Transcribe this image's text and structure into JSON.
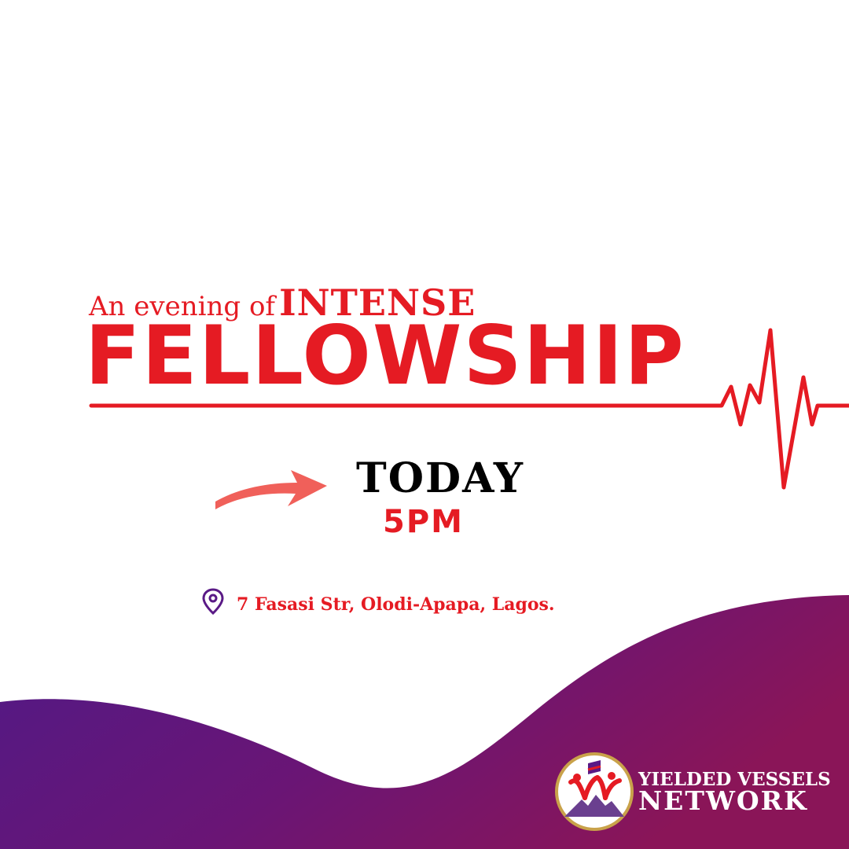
{
  "headline": {
    "pre_title": "An evening of",
    "pre_title_emphasis": "INTENSE",
    "title": "FELLOWSHIP"
  },
  "event": {
    "day": "TODAY",
    "time": "5PM",
    "address": "7 Fasasi Str, Olodi-Apapa, Lagos."
  },
  "organization": {
    "name_line1": "YIELDED VESSELS",
    "name_line2": "NETWORK"
  },
  "icons": {
    "arrow": "arrow-right-icon",
    "location": "location-pin-icon",
    "heartbeat": "heartbeat-line-icon",
    "logo": "organization-logo-icon"
  },
  "colors": {
    "accent_red": "#e51b23",
    "arrow_coral": "#f0605a",
    "wave_purple": "#5a1a86",
    "wave_magenta": "#8a1a5a",
    "text_dark": "#000000"
  }
}
